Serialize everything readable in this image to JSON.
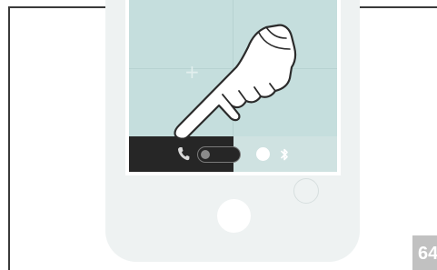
{
  "illustration": {
    "device": "smartphone",
    "screen": {
      "quick_settings": [
        {
          "icon": "phone-icon",
          "state": "off"
        },
        {
          "icon": "toggle-switch",
          "state": "off"
        },
        {
          "icon": "circle-toggle",
          "state": "on"
        },
        {
          "icon": "bluetooth-icon",
          "state": "on"
        }
      ],
      "pointer": "hand-pointer-icon"
    }
  },
  "colors": {
    "screen": "#c5dedd",
    "bar_dark": "#262626",
    "phone_body": "#eef2f2",
    "page_tab": "#c1c1c1"
  },
  "page": {
    "number": "64"
  }
}
